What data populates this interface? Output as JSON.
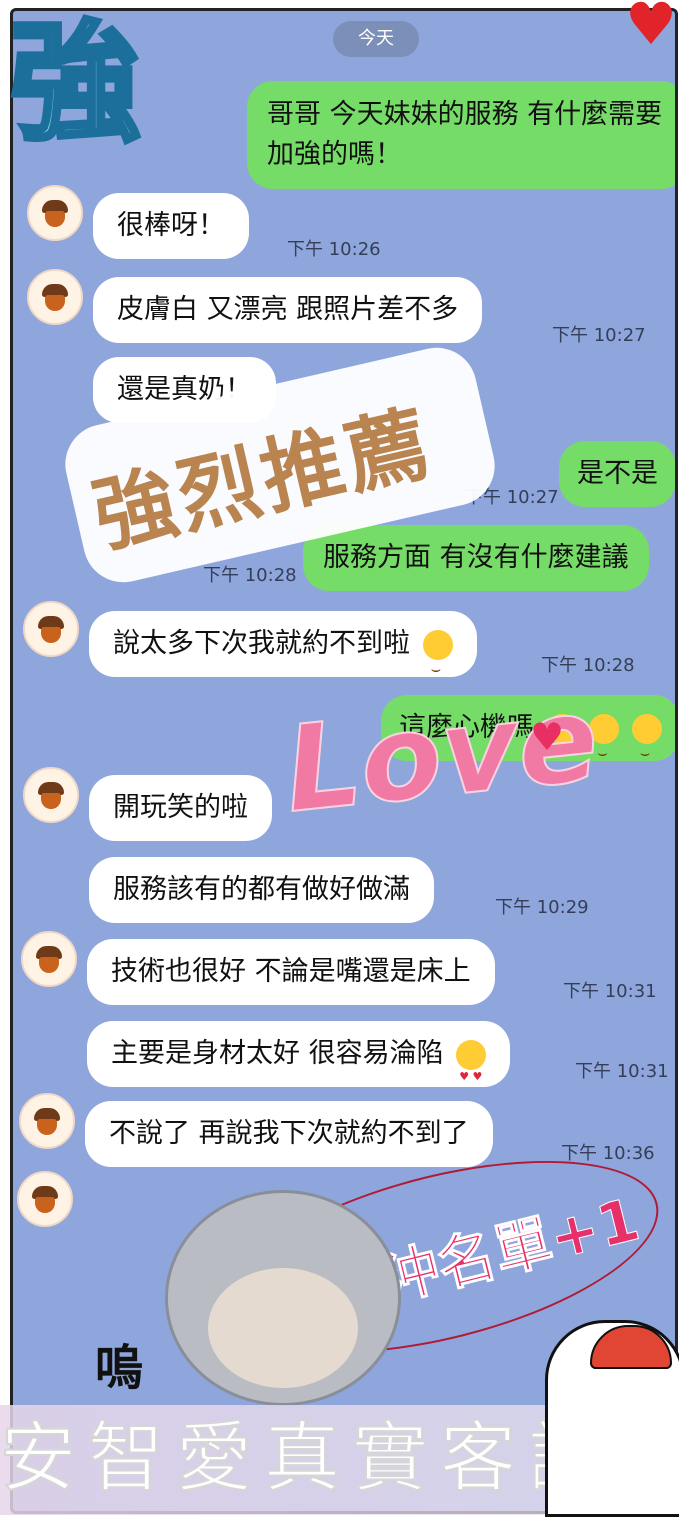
{
  "date_label": "今天",
  "messages": [
    {
      "side": "out",
      "text": "哥哥 今天妹妹的服務 有什麼需要加強的嗎！"
    },
    {
      "side": "in",
      "text": "很棒呀！",
      "time": "下午 10:26"
    },
    {
      "side": "in",
      "text": "皮膚白 又漂亮 跟照片差不多",
      "time": "下午 10:27"
    },
    {
      "side": "in",
      "text": "還是真奶！"
    },
    {
      "side": "out",
      "text": "是不是",
      "time": "下午 10:27"
    },
    {
      "side": "out",
      "text": "服務方面 有沒有什麼建議",
      "time": "下午 10:28"
    },
    {
      "side": "in",
      "text": "說太多下次我就約不到啦",
      "time": "下午 10:28"
    },
    {
      "side": "out",
      "text": "這麼心機嗎"
    },
    {
      "side": "in",
      "text": "開玩笑的啦"
    },
    {
      "side": "in",
      "text": "服務該有的都有做好做滿",
      "time": "下午 10:29"
    },
    {
      "side": "in",
      "text": "技術也很好 不論是嘴還是床上",
      "time": "下午 10:31"
    },
    {
      "side": "in",
      "text": "主要是身材太好 很容易淪陷",
      "time": "下午 10:31"
    },
    {
      "side": "in",
      "text": "不說了 再說我下次就約不到了",
      "time": "下午 10:36"
    }
  ],
  "stickers": {
    "strong": "強",
    "recommend": "強烈推薦",
    "love": "Love",
    "callback": "回沖名單+1",
    "wu": "嗚",
    "footer": "安智愛真實客評"
  },
  "colors": {
    "background": "#8ea6dc",
    "bubble_in": "#ffffff",
    "bubble_out": "#76dc68"
  },
  "icons": {
    "avatar": "acorn-icon",
    "emoji_laugh": "rolling-laugh-emoji",
    "emoji_love": "heart-eyes-emoji",
    "emoji_tears": "tears-of-joy-emoji"
  }
}
